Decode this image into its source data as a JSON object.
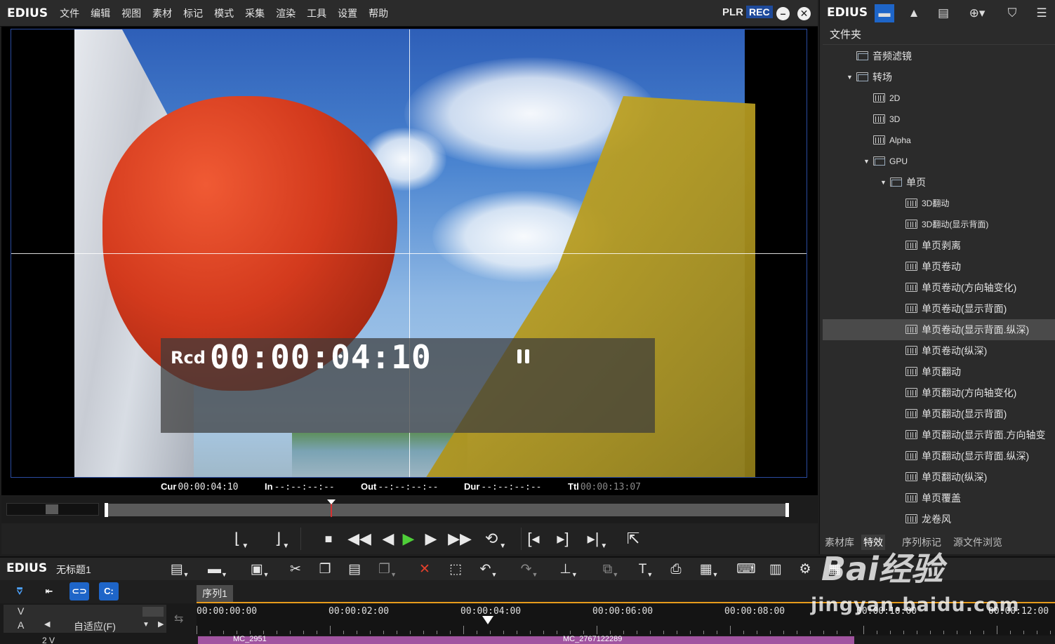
{
  "app": {
    "logo": "EDIUS"
  },
  "menubar": {
    "items": [
      "文件",
      "编辑",
      "视图",
      "素材",
      "标记",
      "模式",
      "采集",
      "渲染",
      "工具",
      "设置",
      "帮助"
    ],
    "plr": "PLR",
    "rec": "REC"
  },
  "preview": {
    "rcd_label": "Rcd",
    "timecode": "00:00:04:10",
    "state": "paused"
  },
  "status": {
    "cur_label": "Cur",
    "cur": "00:00:04:10",
    "in_label": "In",
    "in": "--:--:--:--",
    "out_label": "Out",
    "out": "--:--:--:--",
    "dur_label": "Dur",
    "dur": "--:--:--:--",
    "ttl_label": "Ttl",
    "ttl": "00:00:13:07"
  },
  "scrub": {
    "position_fraction": 0.33
  },
  "right_panel": {
    "logo": "EDIUS",
    "header": "文件夹",
    "tree": [
      {
        "label": "音频滤镜",
        "indent": 0,
        "arrow": "",
        "icon": "folder"
      },
      {
        "label": "转场",
        "indent": 0,
        "arrow": "▼",
        "icon": "folder"
      },
      {
        "label": "2D",
        "indent": 1,
        "arrow": "",
        "icon": "fx"
      },
      {
        "label": "3D",
        "indent": 1,
        "arrow": "",
        "icon": "fx"
      },
      {
        "label": "Alpha",
        "indent": 1,
        "arrow": "",
        "icon": "fx"
      },
      {
        "label": "GPU",
        "indent": 1,
        "arrow": "▼",
        "icon": "folder"
      },
      {
        "label": "单页",
        "indent": 2,
        "arrow": "▼",
        "icon": "folder"
      },
      {
        "label": "3D翻动",
        "indent": 3,
        "arrow": "",
        "icon": "fx"
      },
      {
        "label": "3D翻动(显示背面)",
        "indent": 3,
        "arrow": "",
        "icon": "fx"
      },
      {
        "label": "单页剥离",
        "indent": 3,
        "arrow": "",
        "icon": "fx"
      },
      {
        "label": "单页卷动",
        "indent": 3,
        "arrow": "",
        "icon": "fx"
      },
      {
        "label": "单页卷动(方向轴变化)",
        "indent": 3,
        "arrow": "",
        "icon": "fx"
      },
      {
        "label": "单页卷动(显示背面)",
        "indent": 3,
        "arrow": "",
        "icon": "fx"
      },
      {
        "label": "单页卷动(显示背面.纵深)",
        "indent": 3,
        "arrow": "",
        "icon": "fx",
        "selected": true
      },
      {
        "label": "单页卷动(纵深)",
        "indent": 3,
        "arrow": "",
        "icon": "fx"
      },
      {
        "label": "单页翻动",
        "indent": 3,
        "arrow": "",
        "icon": "fx"
      },
      {
        "label": "单页翻动(方向轴变化)",
        "indent": 3,
        "arrow": "",
        "icon": "fx"
      },
      {
        "label": "单页翻动(显示背面)",
        "indent": 3,
        "arrow": "",
        "icon": "fx"
      },
      {
        "label": "单页翻动(显示背面.方向轴变",
        "indent": 3,
        "arrow": "",
        "icon": "fx"
      },
      {
        "label": "单页翻动(显示背面.纵深)",
        "indent": 3,
        "arrow": "",
        "icon": "fx"
      },
      {
        "label": "单页翻动(纵深)",
        "indent": 3,
        "arrow": "",
        "icon": "fx"
      },
      {
        "label": "单页覆盖",
        "indent": 3,
        "arrow": "",
        "icon": "fx"
      },
      {
        "label": "龙卷风",
        "indent": 3,
        "arrow": "",
        "icon": "fx"
      }
    ],
    "tabs": [
      "素材库",
      "特效",
      "序列标记",
      "源文件浏览"
    ],
    "active_tab": "特效"
  },
  "timeline": {
    "logo": "EDIUS",
    "project_title": "无标题1",
    "sequence_tab": "序列1",
    "track_v": "V",
    "track_a": "A",
    "fit_mode": "自适应(F)",
    "track_2v": "2 V",
    "ruler": [
      "00:00:00:00",
      "00:00:02:00",
      "00:00:04:00",
      "00:00:06:00",
      "00:00:08:00",
      "00:00:10:00",
      "00:00:12:00"
    ],
    "clip1": "MC_2951",
    "clip2": "MC_2767122289"
  },
  "watermark": {
    "text": "Bai经验",
    "url": "jingyan.baidu.com"
  }
}
